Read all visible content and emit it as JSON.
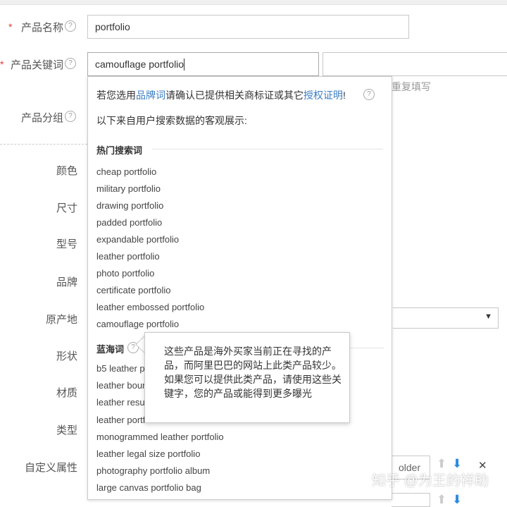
{
  "form": {
    "required_mark": "*",
    "help_glyph": "?",
    "product_name": {
      "label": "产品名称",
      "value": "portfolio"
    },
    "product_keyword": {
      "label": "产品关键词",
      "value": "camouflage portfolio",
      "secondary_hint": "重复填写"
    },
    "product_group": {
      "label": "产品分组"
    },
    "attributes": [
      "颜色",
      "尺寸",
      "型号",
      "品牌",
      "原产地",
      "形状",
      "材质",
      "类型",
      "自定义属性"
    ],
    "origin_caret": "▼",
    "custom_value_fragment": "older",
    "custom_controls": {
      "up": "⬆",
      "down": "⬇",
      "remove": "✕"
    }
  },
  "suggest": {
    "brand_notice_prefix": "若您选用",
    "brand_link": "品牌词",
    "brand_notice_middle": "请确认已提供相关商标证或其它",
    "auth_link": "授权证明",
    "brand_notice_suffix": "!",
    "data_source_note": "以下来自用户搜索数据的客观展示:",
    "hot_title": "热门搜索词",
    "hot_keywords": [
      "cheap portfolio",
      "military portfolio",
      "drawing portfolio",
      "padded portfolio",
      "expandable portfolio",
      "leather portfolio",
      "photo portfolio",
      "certificate portfolio",
      "leather embossed portfolio",
      "camouflage portfolio"
    ],
    "blue_title": "蓝海词",
    "blue_keywords": [
      "b5 leather po",
      "leather boun",
      "leather resur",
      "leather portf",
      "monogrammed leather portfolio",
      "leather legal size portfolio",
      "photography portfolio album",
      "large canvas portfolio bag"
    ]
  },
  "tooltip": {
    "text": "这些产品是海外买家当前正在寻找的产品，而阿里巴巴的网站上此类产品较少。如果您可以提供此类产品，请使用这些关键字，您的产品或能得到更多曝光"
  },
  "watermark": "知乎 @为王的祥助"
}
